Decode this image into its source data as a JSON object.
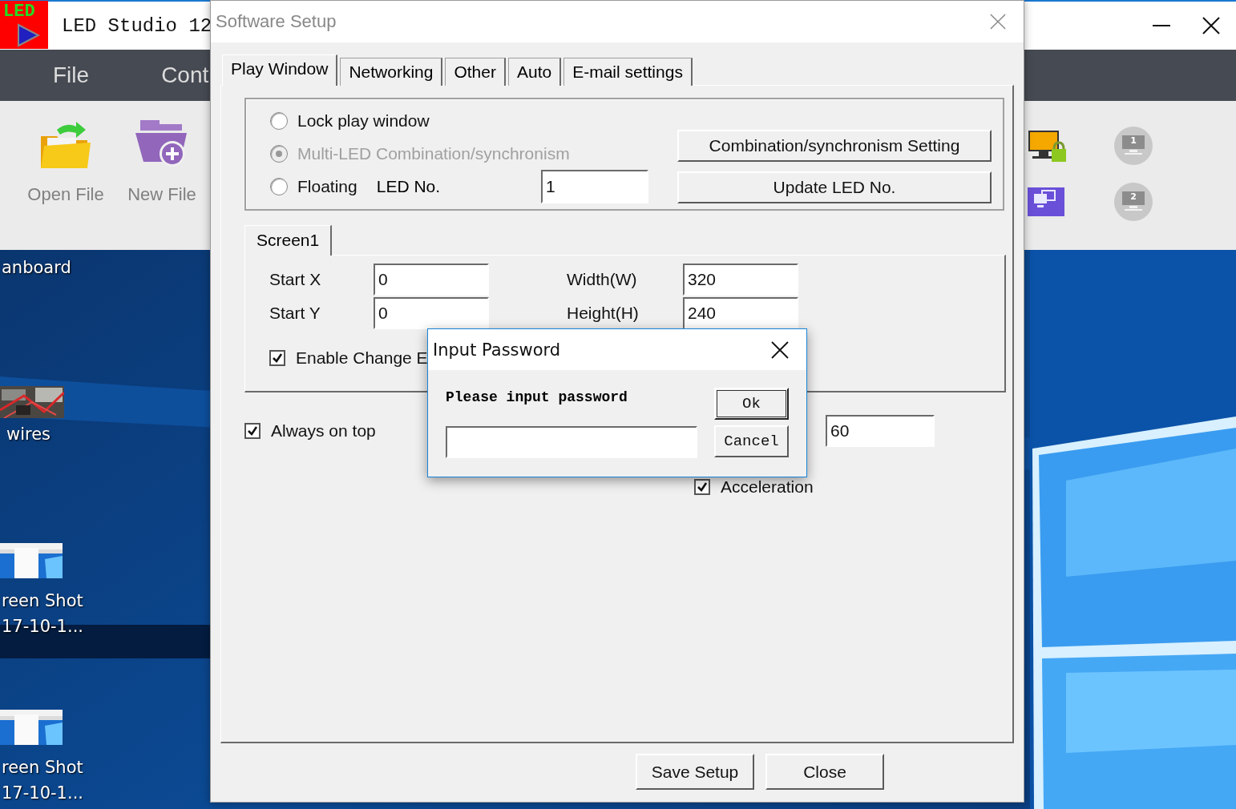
{
  "desktop": {
    "icons": [
      {
        "kind": "none",
        "lines": [
          "anboard"
        ]
      },
      {
        "lines": [
          "wires"
        ]
      },
      {
        "kind": "screenshot",
        "lines": [
          "reen Shot",
          "17-10-1..."
        ]
      },
      {
        "kind": "screenshot",
        "lines": [
          "reen Shot",
          "17-10-1..."
        ]
      }
    ]
  },
  "app": {
    "logo_text": "LED",
    "title": "LED Studio 12",
    "menu": [
      "File",
      "Cont"
    ],
    "toolbar": [
      {
        "kind": "open",
        "label": "Open File"
      },
      {
        "kind": "new",
        "label": "New File"
      }
    ],
    "screen_buttons": [
      {
        "number": "1"
      },
      {
        "number": "2"
      }
    ]
  },
  "software_setup": {
    "title": "Software Setup",
    "tabs": [
      {
        "label": "Play Window",
        "selected": true
      },
      {
        "label": "Networking",
        "selected": false
      },
      {
        "label": "Other",
        "selected": false
      },
      {
        "label": "Auto",
        "selected": false
      },
      {
        "label": "E-mail settings",
        "selected": false
      }
    ],
    "mode_radios": [
      {
        "label": "Lock play window",
        "selected": false,
        "disabled": false
      },
      {
        "label": "Multi-LED Combination/synchronism",
        "selected": true,
        "disabled": true
      },
      {
        "label": "Floating",
        "selected": false,
        "disabled": false
      }
    ],
    "led_no": {
      "label": "LED No.",
      "value": "1"
    },
    "group_buttons": [
      "Combination/synchronism Setting",
      "Update LED No."
    ],
    "screen_tabs": [
      {
        "label": "Screen1",
        "selected": true
      }
    ],
    "fields": [
      {
        "label": "Start X",
        "value": "0"
      },
      {
        "label": "Width(W)",
        "value": "320"
      },
      {
        "label": "Start Y",
        "value": "0"
      },
      {
        "label": "Height(H)",
        "value": "240"
      }
    ],
    "enable_change": {
      "label": "Enable Change E",
      "checked": true
    },
    "always_on_top": {
      "label": "Always on top",
      "checked": true
    },
    "interval_value": "60",
    "acceleration": {
      "label": "Acceleration",
      "checked": true
    },
    "buttons": [
      "Save Setup",
      "Close"
    ]
  },
  "password_dialog": {
    "title": "Input Password",
    "prompt": "Please input password",
    "buttons": [
      "Ok",
      "Cancel"
    ]
  }
}
